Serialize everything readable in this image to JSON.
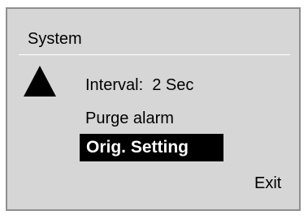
{
  "header": {
    "title": "System"
  },
  "icons": {
    "scroll_up": "up-triangle-icon"
  },
  "menu": {
    "items": [
      {
        "label": "Interval:  2 Sec",
        "selected": false
      },
      {
        "label": "Purge alarm",
        "selected": false
      },
      {
        "label": "Orig. Setting",
        "selected": true
      }
    ]
  },
  "footer": {
    "exit_label": "Exit"
  },
  "colors": {
    "screen_background": "#d6d6d6",
    "selection_background": "#000000",
    "selection_text": "#ffffff",
    "text": "#000000"
  }
}
